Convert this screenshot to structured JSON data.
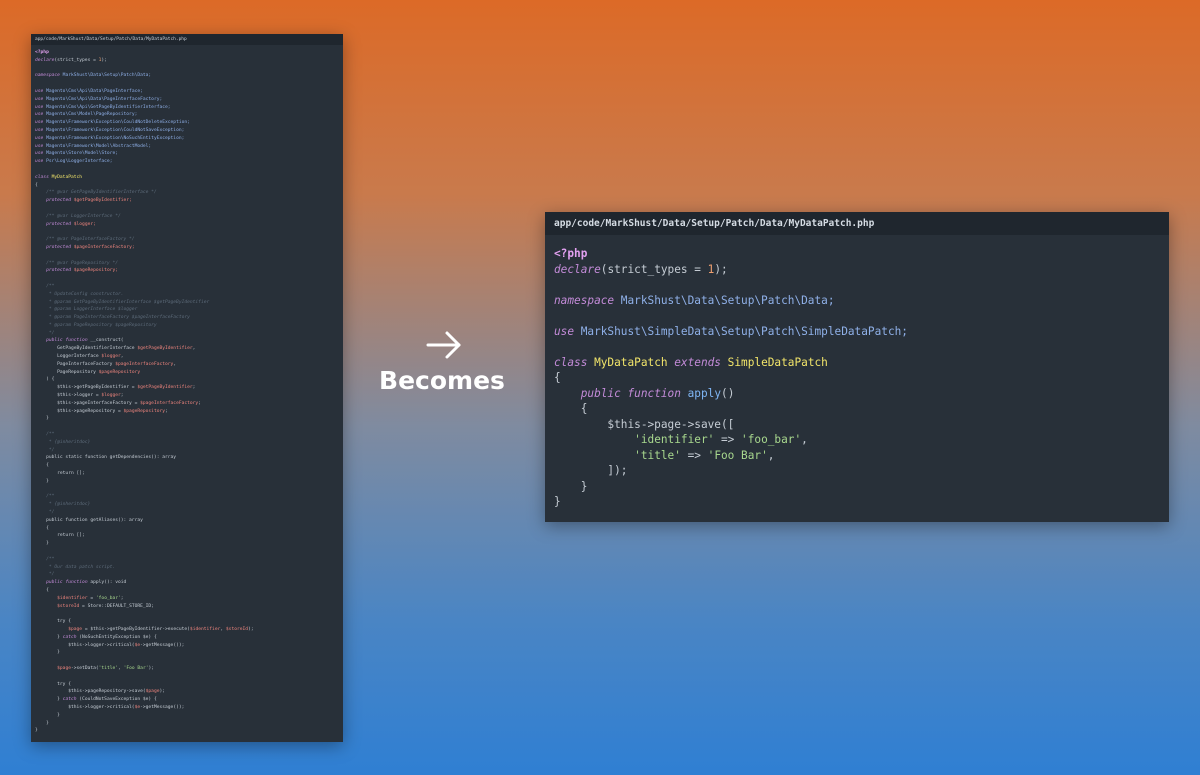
{
  "left_panel": {
    "path": "app/code/MarkShust/Data/Setup/Patch/Data/MyDataPatch.php",
    "lines": [
      [
        [
          "<?php",
          "tag"
        ]
      ],
      [
        [
          "declare",
          "kw"
        ],
        [
          "(strict_types = ",
          "pl"
        ],
        [
          "1",
          "num"
        ],
        [
          ");",
          "pl"
        ]
      ],
      [],
      [
        [
          "namespace ",
          "kw"
        ],
        [
          "MarkShust\\Data\\Setup\\Patch\\Data;",
          "ns"
        ]
      ],
      [],
      [
        [
          "use ",
          "kw"
        ],
        [
          "Magento\\Cms\\Api\\Data\\PageInterface;",
          "ns"
        ]
      ],
      [
        [
          "use ",
          "kw"
        ],
        [
          "Magento\\Cms\\Api\\Data\\PageInterfaceFactory;",
          "ns"
        ]
      ],
      [
        [
          "use ",
          "kw"
        ],
        [
          "Magento\\Cms\\Api\\GetPageByIdentifierInterface;",
          "ns"
        ]
      ],
      [
        [
          "use ",
          "kw"
        ],
        [
          "Magento\\Cms\\Model\\PageRepository;",
          "ns"
        ]
      ],
      [
        [
          "use ",
          "kw"
        ],
        [
          "Magento\\Framework\\Exception\\CouldNotDeleteException;",
          "ns"
        ]
      ],
      [
        [
          "use ",
          "kw"
        ],
        [
          "Magento\\Framework\\Exception\\CouldNotSaveException;",
          "ns"
        ]
      ],
      [
        [
          "use ",
          "kw"
        ],
        [
          "Magento\\Framework\\Exception\\NoSuchEntityException;",
          "ns"
        ]
      ],
      [
        [
          "use ",
          "kw"
        ],
        [
          "Magento\\Framework\\Model\\AbstractModel;",
          "ns"
        ]
      ],
      [
        [
          "use ",
          "kw"
        ],
        [
          "Magento\\Store\\Model\\Store;",
          "ns"
        ]
      ],
      [
        [
          "use ",
          "kw"
        ],
        [
          "Psr\\Log\\LoggerInterface;",
          "ns"
        ]
      ],
      [],
      [
        [
          "class ",
          "kw"
        ],
        [
          "MyDataPatch",
          "cls"
        ]
      ],
      [
        [
          "{",
          "pl"
        ]
      ],
      [
        [
          "    /** @var GetPageByIdentifierInterface */",
          "cm"
        ]
      ],
      [
        [
          "    ",
          "pl"
        ],
        [
          "protected ",
          "kw"
        ],
        [
          "$getPageByIdentifier;",
          "var"
        ]
      ],
      [],
      [
        [
          "    /** @var LoggerInterface */",
          "cm"
        ]
      ],
      [
        [
          "    ",
          "pl"
        ],
        [
          "protected ",
          "kw"
        ],
        [
          "$logger;",
          "var"
        ]
      ],
      [],
      [
        [
          "    /** @var PageInterfaceFactory */",
          "cm"
        ]
      ],
      [
        [
          "    ",
          "pl"
        ],
        [
          "protected ",
          "kw"
        ],
        [
          "$pageInterfaceFactory;",
          "var"
        ]
      ],
      [],
      [
        [
          "    /** @var PageRepository */",
          "cm"
        ]
      ],
      [
        [
          "    ",
          "pl"
        ],
        [
          "protected ",
          "kw"
        ],
        [
          "$pageRepository;",
          "var"
        ]
      ],
      [],
      [
        [
          "    /**",
          "cm"
        ]
      ],
      [
        [
          "     * UpdateConfig constructor.",
          "cm"
        ]
      ],
      [
        [
          "     * @param GetPageByIdentifierInterface $getPageByIdentifier",
          "cm"
        ]
      ],
      [
        [
          "     * @param LoggerInterface $logger",
          "cm"
        ]
      ],
      [
        [
          "     * @param PageInterfaceFactory $pageInterfaceFactory",
          "cm"
        ]
      ],
      [
        [
          "     * @param PageRepository $pageRepository",
          "cm"
        ]
      ],
      [
        [
          "     */",
          "cm"
        ]
      ],
      [
        [
          "    ",
          "pl"
        ],
        [
          "public ",
          "kw"
        ],
        [
          "function ",
          "kw"
        ],
        [
          "__construct(",
          "pl"
        ]
      ],
      [
        [
          "        GetPageByIdentifierInterface ",
          "pl"
        ],
        [
          "$getPageByIdentifier",
          "var"
        ],
        [
          ",",
          "pl"
        ]
      ],
      [
        [
          "        LoggerInterface ",
          "pl"
        ],
        [
          "$logger",
          "var"
        ],
        [
          ",",
          "pl"
        ]
      ],
      [
        [
          "        PageInterfaceFactory ",
          "pl"
        ],
        [
          "$pageInterfaceFactory",
          "var"
        ],
        [
          ",",
          "pl"
        ]
      ],
      [
        [
          "        PageRepository ",
          "pl"
        ],
        [
          "$pageRepository",
          "var"
        ]
      ],
      [
        [
          "    ) {",
          "pl"
        ]
      ],
      [
        [
          "        $this->getPageByIdentifier = ",
          "pl"
        ],
        [
          "$getPageByIdentifier",
          "var"
        ],
        [
          ";",
          "pl"
        ]
      ],
      [
        [
          "        $this->logger = ",
          "pl"
        ],
        [
          "$logger",
          "var"
        ],
        [
          ";",
          "pl"
        ]
      ],
      [
        [
          "        $this->pageInterfaceFactory = ",
          "pl"
        ],
        [
          "$pageInterfaceFactory",
          "var"
        ],
        [
          ";",
          "pl"
        ]
      ],
      [
        [
          "        $this->pageRepository = ",
          "pl"
        ],
        [
          "$pageRepository",
          "var"
        ],
        [
          ";",
          "pl"
        ]
      ],
      [
        [
          "    }",
          "pl"
        ]
      ],
      [],
      [
        [
          "    /**",
          "cm"
        ]
      ],
      [
        [
          "     * {@inheritdoc}",
          "cm"
        ]
      ],
      [
        [
          "     */",
          "cm"
        ]
      ],
      [
        [
          "    public static function getDependencies(): array",
          "pl"
        ]
      ],
      [
        [
          "    {",
          "pl"
        ]
      ],
      [
        [
          "        return [];",
          "pl"
        ]
      ],
      [
        [
          "    }",
          "pl"
        ]
      ],
      [],
      [
        [
          "    /**",
          "cm"
        ]
      ],
      [
        [
          "     * {@inheritdoc}",
          "cm"
        ]
      ],
      [
        [
          "     */",
          "cm"
        ]
      ],
      [
        [
          "    public function getAliases(): array",
          "pl"
        ]
      ],
      [
        [
          "    {",
          "pl"
        ]
      ],
      [
        [
          "        return [];",
          "pl"
        ]
      ],
      [
        [
          "    }",
          "pl"
        ]
      ],
      [],
      [
        [
          "    /**",
          "cm"
        ]
      ],
      [
        [
          "     * Our data patch script.",
          "cm"
        ]
      ],
      [
        [
          "     */",
          "cm"
        ]
      ],
      [
        [
          "    ",
          "pl"
        ],
        [
          "public ",
          "kw"
        ],
        [
          "function ",
          "kw"
        ],
        [
          "apply(): void",
          "pl"
        ]
      ],
      [
        [
          "    {",
          "pl"
        ]
      ],
      [
        [
          "        ",
          "pl"
        ],
        [
          "$identifier",
          "var"
        ],
        [
          " = ",
          "pl"
        ],
        [
          "'foo_bar'",
          "str"
        ],
        [
          ";",
          "pl"
        ]
      ],
      [
        [
          "        ",
          "pl"
        ],
        [
          "$storeId",
          "var"
        ],
        [
          " = Store::DEFAULT_STORE_ID;",
          "pl"
        ]
      ],
      [],
      [
        [
          "        try {",
          "pl"
        ]
      ],
      [
        [
          "            ",
          "pl"
        ],
        [
          "$page",
          "var"
        ],
        [
          " = $this->getPageByIdentifier->execute(",
          "pl"
        ],
        [
          "$identifier",
          "var"
        ],
        [
          ", ",
          "pl"
        ],
        [
          "$storeId",
          "var"
        ],
        [
          ");",
          "pl"
        ]
      ],
      [
        [
          "        } ",
          "pl"
        ],
        [
          "catch ",
          "kw"
        ],
        [
          "(NoSuchEntityException $e) {",
          "pl"
        ]
      ],
      [
        [
          "            $this->logger->critical(",
          "pl"
        ],
        [
          "$e",
          "var"
        ],
        [
          "->getMessage());",
          "pl"
        ]
      ],
      [
        [
          "        }",
          "pl"
        ]
      ],
      [],
      [
        [
          "        ",
          "pl"
        ],
        [
          "$page",
          "var"
        ],
        [
          "->setData(",
          "pl"
        ],
        [
          "'title'",
          "str"
        ],
        [
          ", ",
          "pl"
        ],
        [
          "'Foo Bar'",
          "str"
        ],
        [
          ");",
          "pl"
        ]
      ],
      [],
      [
        [
          "        try {",
          "pl"
        ]
      ],
      [
        [
          "            $this->pageRepository->save(",
          "pl"
        ],
        [
          "$page",
          "var"
        ],
        [
          ");",
          "pl"
        ]
      ],
      [
        [
          "        } ",
          "pl"
        ],
        [
          "catch ",
          "kw"
        ],
        [
          "(CouldNotSaveException $e) {",
          "pl"
        ]
      ],
      [
        [
          "            $this->logger->critical(",
          "pl"
        ],
        [
          "$e",
          "var"
        ],
        [
          "->getMessage());",
          "pl"
        ]
      ],
      [
        [
          "        }",
          "pl"
        ]
      ],
      [
        [
          "    }",
          "pl"
        ]
      ],
      [
        [
          "}",
          "pl"
        ]
      ]
    ]
  },
  "middle": {
    "label": "Becomes"
  },
  "right_panel": {
    "path": "app/code/MarkShust/Data/Setup/Patch/Data/MyDataPatch.php",
    "lines": [
      [
        [
          "<?php",
          "tag"
        ]
      ],
      [
        [
          "declare",
          "kw"
        ],
        [
          "(strict_types = ",
          "pl"
        ],
        [
          "1",
          "num"
        ],
        [
          ");",
          "pl"
        ]
      ],
      [],
      [
        [
          "namespace ",
          "kw"
        ],
        [
          "MarkShust\\Data\\Setup\\Patch\\Data;",
          "ns"
        ]
      ],
      [],
      [
        [
          "use ",
          "kw"
        ],
        [
          "MarkShust\\SimpleData\\Setup\\Patch\\SimpleDataPatch;",
          "ns"
        ]
      ],
      [],
      [
        [
          "class ",
          "kw"
        ],
        [
          "MyDataPatch ",
          "cls"
        ],
        [
          "extends ",
          "kw"
        ],
        [
          "SimpleDataPatch",
          "cls"
        ]
      ],
      [
        [
          "{",
          "pl"
        ]
      ],
      [
        [
          "    ",
          "pl"
        ],
        [
          "public ",
          "kw"
        ],
        [
          "function ",
          "kw"
        ],
        [
          "apply",
          "fn"
        ],
        [
          "()",
          "pl"
        ]
      ],
      [
        [
          "    {",
          "pl"
        ]
      ],
      [
        [
          "        $this->page->save([",
          "pl"
        ]
      ],
      [
        [
          "            ",
          "pl"
        ],
        [
          "'identifier'",
          "str"
        ],
        [
          " => ",
          "pl"
        ],
        [
          "'foo_bar'",
          "str"
        ],
        [
          ",",
          "pl"
        ]
      ],
      [
        [
          "            ",
          "pl"
        ],
        [
          "'title'",
          "str"
        ],
        [
          " => ",
          "pl"
        ],
        [
          "'Foo Bar'",
          "str"
        ],
        [
          ",",
          "pl"
        ]
      ],
      [
        [
          "        ]);",
          "pl"
        ]
      ],
      [
        [
          "    }",
          "pl"
        ]
      ],
      [
        [
          "}",
          "pl"
        ]
      ]
    ]
  }
}
